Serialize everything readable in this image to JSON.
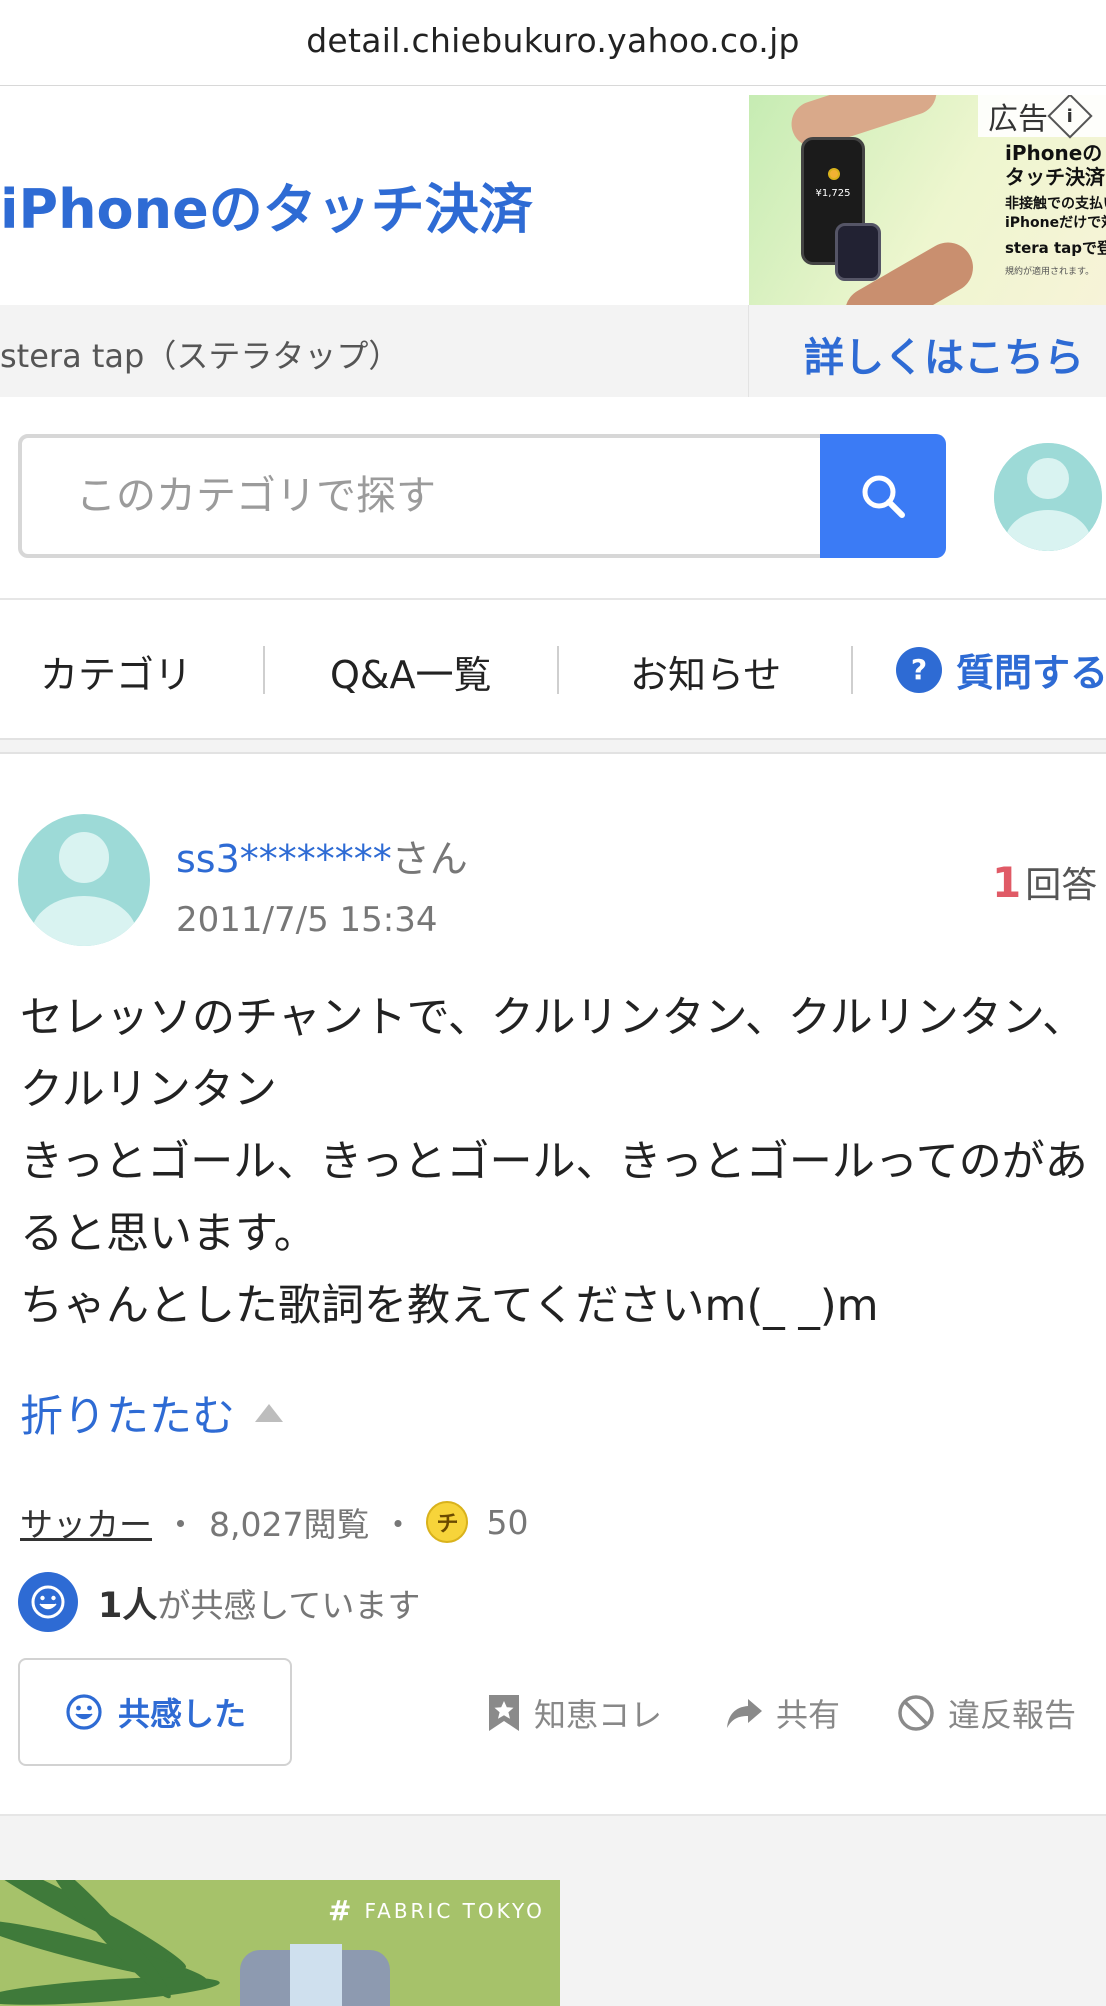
{
  "browser": {
    "url": "detail.chiebukuro.yahoo.co.jp"
  },
  "ad_top": {
    "headline": "iPhoneのタッチ決済",
    "badge": "広告",
    "image_title": "iPhoneの\nタッチ決済",
    "image_line1": "非接触での支払いに。",
    "image_line2": "iPhoneだけで対応。",
    "image_line3": "stera tapで登場",
    "image_fine": "規約が適用されます。",
    "image_price": "¥1,725",
    "sub": "stera tap（ステラタップ）",
    "cta": "詳しくはこちら"
  },
  "search": {
    "placeholder": "このカテゴリで探す"
  },
  "nav": {
    "items": [
      "カテゴリ",
      "Q&A一覧",
      "お知らせ"
    ],
    "ask": "質問する",
    "ask_icon": "?"
  },
  "question": {
    "user_name": "ss3********",
    "user_suffix": "さん",
    "date": "2011/7/5 15:34",
    "answer_count": "1",
    "answer_label": "回答",
    "body": "セレッソのチャントで、クルリンタン、クルリンタン、クルリンタン\nきっとゴール、きっとゴール、きっとゴールってのがあると思います。\nちゃんとした歌詞を教えてくださいm(_ _)m",
    "collapse_label": "折りたたむ",
    "category": "サッカー",
    "views": "8,027閲覧",
    "coin_label": "チ",
    "coins": "50",
    "empathy_count": "1人",
    "empathy_text": "が共感しています",
    "empathy_button": "共感した",
    "actions": {
      "bookmark": "知恵コレ",
      "share": "共有",
      "report": "違反報告"
    }
  },
  "ad_bottom": {
    "brand": "FABRIC TOKYO"
  },
  "colors": {
    "link_blue": "#2e6bd4",
    "search_blue": "#3b7bf5",
    "answer_red": "#e05a66",
    "avatar_teal": "#9ddad7"
  }
}
